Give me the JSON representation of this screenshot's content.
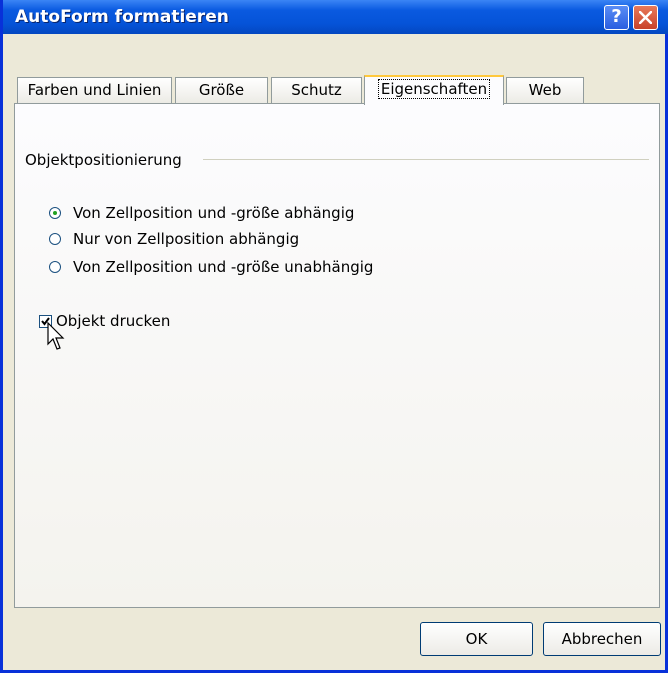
{
  "window": {
    "title": "AutoForm formatieren",
    "help_label": "?"
  },
  "tabs": [
    {
      "label": "Farben und Linien",
      "active": false
    },
    {
      "label": "Größe",
      "active": false
    },
    {
      "label": "Schutz",
      "active": false
    },
    {
      "label": "Eigenschaften",
      "active": true
    },
    {
      "label": "Web",
      "active": false
    }
  ],
  "group": {
    "title": "Objektpositionierung",
    "options": [
      {
        "label": "Von Zellposition und -größe abhängig",
        "selected": true
      },
      {
        "label": "Nur von Zellposition abhängig",
        "selected": false
      },
      {
        "label": "Von Zellposition und -größe unabhängig",
        "selected": false
      }
    ]
  },
  "print_object": {
    "label": "Objekt drucken",
    "checked": true
  },
  "buttons": {
    "ok": "OK",
    "cancel": "Abbrechen"
  }
}
